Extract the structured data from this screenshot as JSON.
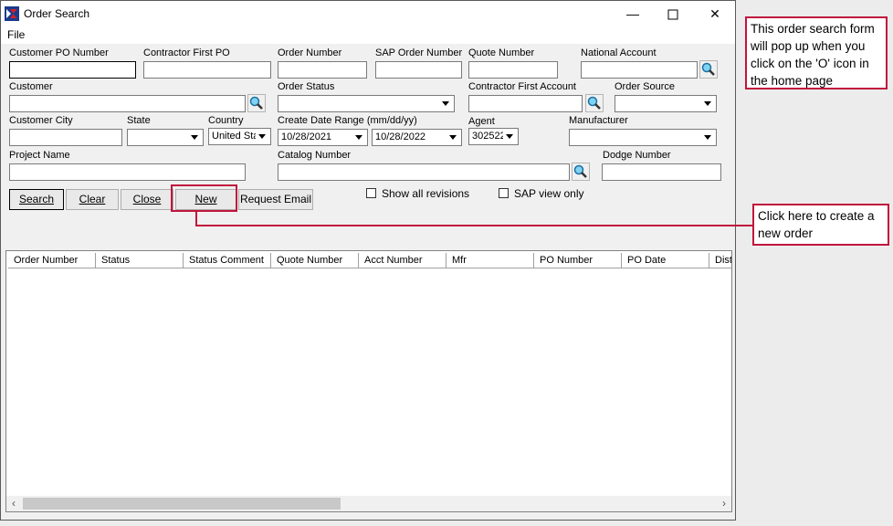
{
  "window": {
    "title": "Order Search",
    "menu": [
      "File"
    ]
  },
  "labels": {
    "customer_po": "Customer PO Number",
    "contractor_first_po": "Contractor First PO",
    "order_number": "Order Number",
    "sap_order_number": "SAP Order Number",
    "quote_number": "Quote Number",
    "national_account": "National Account",
    "customer": "Customer",
    "order_status": "Order Status",
    "contractor_first_account": "Contractor First Account",
    "order_source": "Order Source",
    "customer_city": "Customer City",
    "state": "State",
    "country": "Country",
    "create_date_range": "Create Date Range  (mm/dd/yy)",
    "agent": "Agent",
    "manufacturer": "Manufacturer",
    "project_name": "Project Name",
    "catalog_number": "Catalog Number",
    "dodge_number": "Dodge Number"
  },
  "values": {
    "country": "United Sta",
    "date_from": "10/28/2021",
    "date_to": "10/28/2022",
    "agent": "302522"
  },
  "buttons": {
    "search": "Search",
    "clear": "Clear",
    "close": "Close",
    "new": "New",
    "request_email": "Request Email"
  },
  "checkboxes": {
    "show_all_revisions": "Show all revisions",
    "sap_view_only": "SAP view only"
  },
  "grid_columns": [
    "Order Number",
    "Status",
    "Status Comment",
    "Quote Number",
    "Acct Number",
    "Mfr",
    "PO Number",
    "PO Date",
    "Dist"
  ],
  "callouts": {
    "popup_note": "This order search form will pop up when you click on the 'O' icon in the home page",
    "new_note": "Click here to create a new order"
  },
  "colors": {
    "callout_border": "#c0143c"
  }
}
